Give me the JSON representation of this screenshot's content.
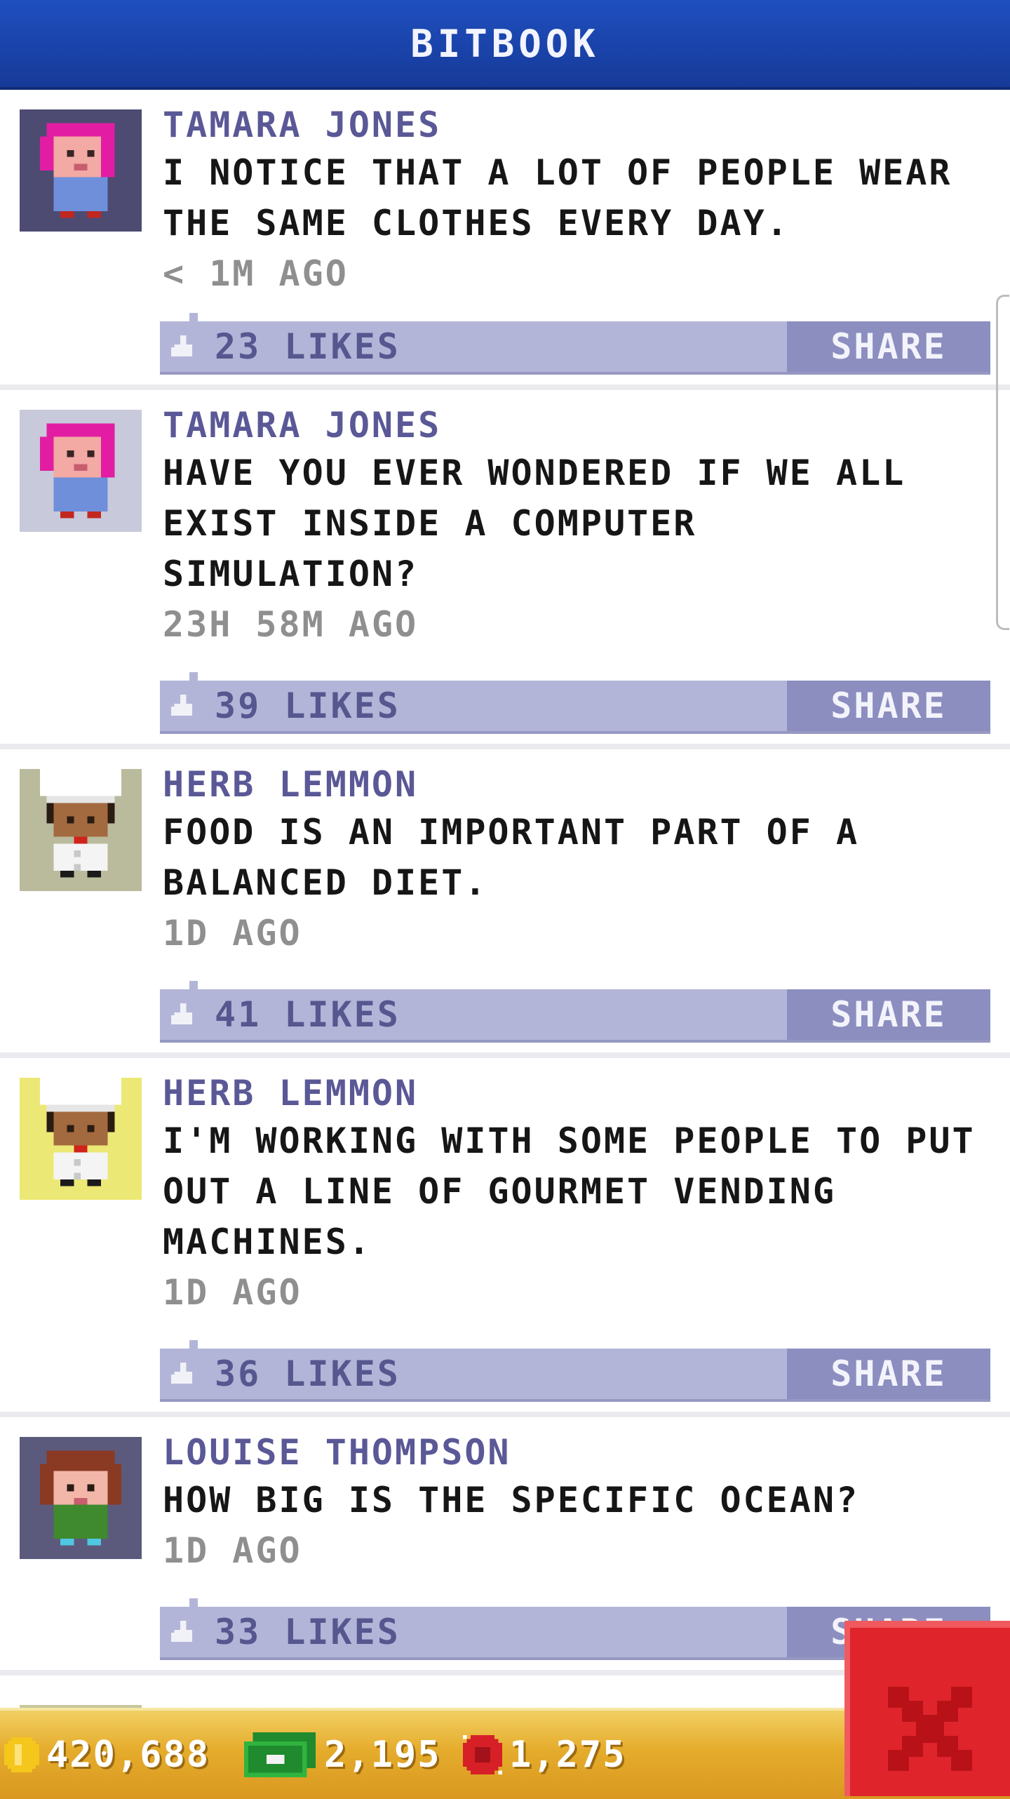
{
  "header": {
    "title": "BITBOOK"
  },
  "posts": [
    {
      "author": "TAMARA JONES",
      "lines": [
        "I NOTICE THAT A LOT OF PEOPLE WEAR",
        "THE SAME CLOTHES EVERY DAY."
      ],
      "time": "< 1M AGO",
      "likes": "23 LIKES",
      "share_label": "SHARE",
      "avatar": {
        "icon": "pink-hair-woman-avatar",
        "bg": "#4d4b72"
      }
    },
    {
      "author": "TAMARA JONES",
      "lines": [
        "HAVE YOU EVER WONDERED IF WE ALL",
        "EXIST INSIDE A COMPUTER",
        "SIMULATION?"
      ],
      "time": "23H 58M AGO",
      "likes": "39 LIKES",
      "share_label": "SHARE",
      "avatar": {
        "icon": "pink-hair-woman-avatar",
        "bg": "#c8c9da"
      }
    },
    {
      "author": "HERB LEMMON",
      "lines": [
        "FOOD IS AN IMPORTANT PART OF A",
        "BALANCED DIET."
      ],
      "time": "1D AGO",
      "likes": "41 LIKES",
      "share_label": "SHARE",
      "avatar": {
        "icon": "chef-avatar",
        "bg": "#b9bb9c"
      }
    },
    {
      "author": "HERB LEMMON",
      "lines": [
        "I'M WORKING WITH SOME PEOPLE TO PUT",
        "OUT A LINE OF GOURMET VENDING",
        "MACHINES."
      ],
      "time": "1D AGO",
      "likes": "36 LIKES",
      "share_label": "SHARE",
      "avatar": {
        "icon": "chef-avatar",
        "bg": "#ece875"
      }
    },
    {
      "author": "LOUISE THOMPSON",
      "lines": [
        "HOW BIG IS THE SPECIFIC OCEAN?"
      ],
      "time": "1D AGO",
      "likes": "33 LIKES",
      "share_label": "SHARE",
      "avatar": {
        "icon": "brown-hair-woman-avatar",
        "bg": "#5b5a7c"
      }
    }
  ],
  "footer": {
    "coins": "420,688",
    "bux": "2,195",
    "tickets": "1,275",
    "icons": [
      "coin-icon",
      "bux-icon",
      "ticket-icon"
    ]
  },
  "close_button": {
    "icon": "close-icon",
    "color": "#e0242c"
  },
  "colors": {
    "header": "#1f4fbf",
    "author": "#5a5896",
    "likes_bar": "#b3b5d8",
    "share_button": "#8c8ec0",
    "footer": "#e5ac2c"
  }
}
